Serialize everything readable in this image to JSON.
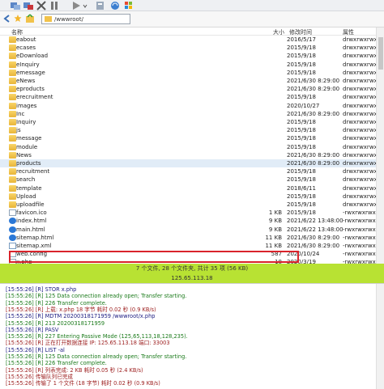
{
  "address": {
    "path": "/wwwroot/"
  },
  "columns": {
    "name": "名称",
    "size": "大小",
    "date": "修改时间",
    "attr": "属性"
  },
  "files": [
    {
      "name": "eabout",
      "size": "",
      "date": "2016/5/17",
      "attr": "drwxrwxrwx",
      "type": "folder"
    },
    {
      "name": "ecases",
      "size": "",
      "date": "2015/9/18",
      "attr": "drwxrwxrwx",
      "type": "folder"
    },
    {
      "name": "eDownload",
      "size": "",
      "date": "2015/9/18",
      "attr": "drwxrwxrwx",
      "type": "folder"
    },
    {
      "name": "eInquiry",
      "size": "",
      "date": "2015/9/18",
      "attr": "drwxrwxrwx",
      "type": "folder"
    },
    {
      "name": "emessage",
      "size": "",
      "date": "2015/9/18",
      "attr": "drwxrwxrwx",
      "type": "folder"
    },
    {
      "name": "eNews",
      "size": "",
      "date": "2021/6/30 8:29:00",
      "attr": "drwxrwxrwx",
      "type": "folder"
    },
    {
      "name": "eproducts",
      "size": "",
      "date": "2021/6/30 8:29:00",
      "attr": "drwxrwxrwx",
      "type": "folder"
    },
    {
      "name": "erecruitment",
      "size": "",
      "date": "2015/9/18",
      "attr": "drwxrwxrwx",
      "type": "folder"
    },
    {
      "name": "images",
      "size": "",
      "date": "2020/10/27",
      "attr": "drwxrwxrwx",
      "type": "folder"
    },
    {
      "name": "Inc",
      "size": "",
      "date": "2021/6/30 8:29:00",
      "attr": "drwxrwxrwx",
      "type": "folder"
    },
    {
      "name": "Inquiry",
      "size": "",
      "date": "2015/9/18",
      "attr": "drwxrwxrwx",
      "type": "folder"
    },
    {
      "name": "js",
      "size": "",
      "date": "2015/9/18",
      "attr": "drwxrwxrwx",
      "type": "folder"
    },
    {
      "name": "message",
      "size": "",
      "date": "2015/9/18",
      "attr": "drwxrwxrwx",
      "type": "folder"
    },
    {
      "name": "module",
      "size": "",
      "date": "2015/9/18",
      "attr": "drwxrwxrwx",
      "type": "folder"
    },
    {
      "name": "News",
      "size": "",
      "date": "2021/6/30 8:29:00",
      "attr": "drwxrwxrwx",
      "type": "folder"
    },
    {
      "name": "products",
      "size": "",
      "date": "2021/6/30 8:29:00",
      "attr": "drwxrwxrwx",
      "type": "folder",
      "selected": true
    },
    {
      "name": "recruitment",
      "size": "",
      "date": "2015/9/18",
      "attr": "drwxrwxrwx",
      "type": "folder"
    },
    {
      "name": "search",
      "size": "",
      "date": "2015/9/18",
      "attr": "drwxrwxrwx",
      "type": "folder"
    },
    {
      "name": "template",
      "size": "",
      "date": "2018/6/11",
      "attr": "drwxrwxrwx",
      "type": "folder"
    },
    {
      "name": "Upload",
      "size": "",
      "date": "2015/9/18",
      "attr": "drwxrwxrwx",
      "type": "folder"
    },
    {
      "name": "uploadfile",
      "size": "",
      "date": "2015/9/18",
      "attr": "drwxrwxrwx",
      "type": "folder"
    },
    {
      "name": "favicon.ico",
      "size": "1 KB",
      "date": "2015/9/18",
      "attr": "-rwxrwxrwx",
      "type": "file"
    },
    {
      "name": "index.html",
      "size": "9 KB",
      "date": "2021/6/22 13:48:00",
      "attr": "-rwxrwxrwx",
      "type": "html"
    },
    {
      "name": "main.html",
      "size": "9 KB",
      "date": "2021/6/22 13:48:00",
      "attr": "-rwxrwxrwx",
      "type": "html"
    },
    {
      "name": "sitemap.html",
      "size": "11 KB",
      "date": "2021/6/30 8:29:00",
      "attr": "-rwxrwxrwx",
      "type": "html"
    },
    {
      "name": "sitemap.xml",
      "size": "11 KB",
      "date": "2021/6/30 8:29:00",
      "attr": "-rwxrwxrwx",
      "type": "xml"
    },
    {
      "name": "web.config",
      "size": "587",
      "date": "2020/10/24",
      "attr": "-rwxrwxrwx",
      "type": "file"
    },
    {
      "name": "x.php",
      "size": "18",
      "date": "2020/3/19",
      "attr": "-rwxrwxrwx",
      "type": "file"
    }
  ],
  "status": {
    "summary": "7 个文件, 28 个文件夹, 共计 35 项 (56 KB)",
    "host": "125.65.113.18"
  },
  "log": [
    {
      "text": "[15:55:26] [R] STOR x.php",
      "color": "#1a1a80"
    },
    {
      "text": "[15:55:26] [R] 125 Data connection already open; Transfer starting.",
      "color": "#1a7a1a"
    },
    {
      "text": "[15:55:26] [R] 226 Transfer complete.",
      "color": "#1a7a1a"
    },
    {
      "text": "[15:55:26] [R] 上载: x.php 18 字节 耗时 0.02 秒 (0.9 KB/s)",
      "color": "#9b1b1b"
    },
    {
      "text": "[15:55:26] [R] MDTM 20200318171959 /wwwroot/x.php",
      "color": "#1a1a80"
    },
    {
      "text": "[15:55:26] [R] 213 20200318171959",
      "color": "#1a7a1a"
    },
    {
      "text": "[15:55:26] [R] PASV",
      "color": "#1a1a80"
    },
    {
      "text": "[15:55:26] [R] 227 Entering Passive Mode (125,65,113,18,128,235).",
      "color": "#1a7a1a"
    },
    {
      "text": "[15:55:26] [R] 正在打开数据连接 IP: 125.65.113.18 端口: 33003",
      "color": "#9b1b1b"
    },
    {
      "text": "[15:55:26] [R] LIST -al",
      "color": "#1a1a80"
    },
    {
      "text": "[15:55:26] [R] 125 Data connection already open; Transfer starting.",
      "color": "#1a7a1a"
    },
    {
      "text": "[15:55:26] [R] 226 Transfer complete.",
      "color": "#1a7a1a"
    },
    {
      "text": "[15:55:26] [R] 列表完成: 2 KB 耗时 0.05 秒 (2.4 KB/s)",
      "color": "#9b1b1b"
    },
    {
      "text": "[15:55:26] 传输队列已完成",
      "color": "#9b1b1b"
    },
    {
      "text": "[15:55:26] 传输了 1 个文件 (18 字节) 耗时 0.02 秒 (0.9 KB/s)",
      "color": "#9b1b1b"
    }
  ],
  "icons": {
    "toolbar": [
      "connect-icon",
      "disconnect-icon",
      "delete-icon",
      "pause-icon",
      "play-icon",
      "transfer-icon",
      "refresh-icon",
      "windows-icon"
    ],
    "addr": [
      "back-icon",
      "favorite-icon",
      "up-folder-icon",
      "folder-icon"
    ]
  },
  "colors": {
    "status_bg": "#b8e233",
    "selection": "#e1ecf7",
    "highlight": "#d9232b"
  }
}
